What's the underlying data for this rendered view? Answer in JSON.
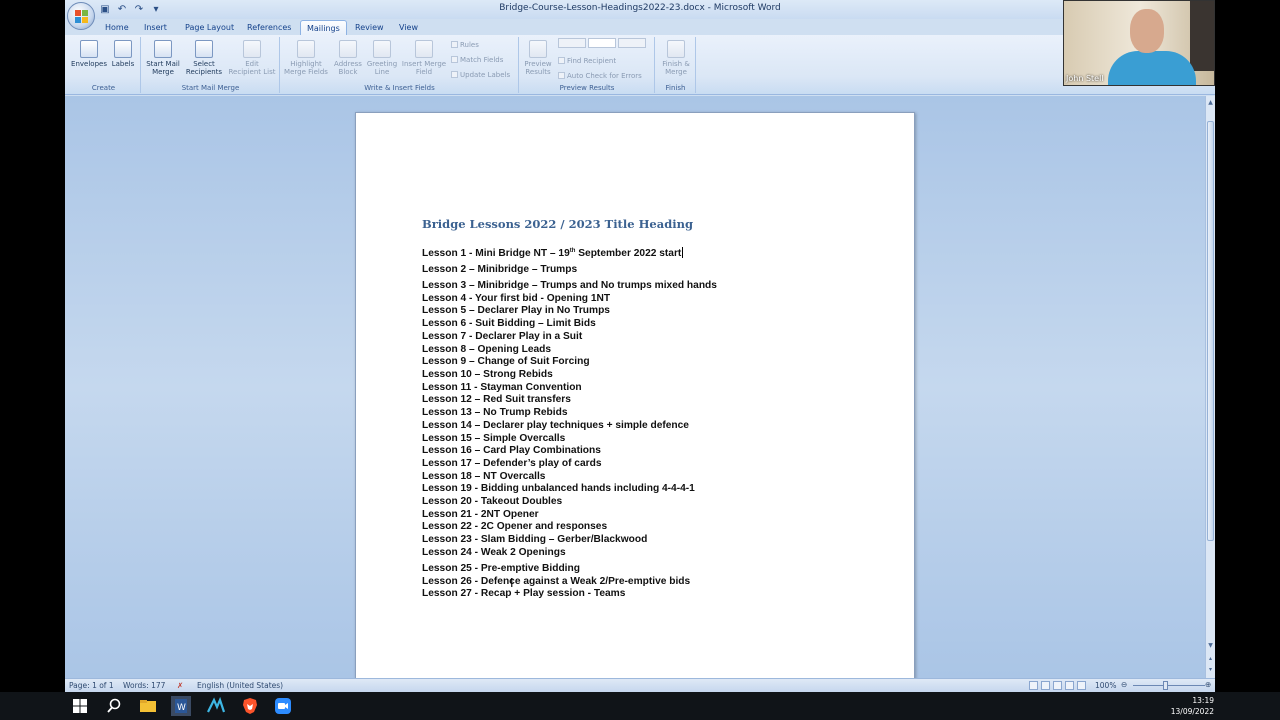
{
  "window": {
    "title": "Bridge-Course-Lesson-Headings2022-23.docx - Microsoft Word"
  },
  "tabs": [
    "Home",
    "Insert",
    "Page Layout",
    "References",
    "Mailings",
    "Review",
    "View"
  ],
  "active_tab": "Mailings",
  "ribbon": {
    "groups": {
      "create": "Create",
      "start_mail_merge": "Start Mail Merge",
      "write_insert": "Write & Insert Fields",
      "preview": "Preview Results",
      "finish": "Finish"
    },
    "buttons": {
      "envelopes": "Envelopes",
      "labels": "Labels",
      "start_mail_merge": "Start Mail Merge",
      "select_recipients": "Select Recipients",
      "edit_recipient_list": "Edit Recipient List",
      "highlight_merge_fields": "Highlight Merge Fields",
      "address_block": "Address Block",
      "greeting_line": "Greeting Line",
      "insert_merge_field": "Insert Merge Field",
      "rules": "Rules",
      "match_fields": "Match Fields",
      "update_labels": "Update Labels",
      "preview_results": "Preview Results",
      "find_recipient": "Find Recipient",
      "auto_check": "Auto Check for Errors",
      "finish_merge": "Finish & Merge"
    }
  },
  "document": {
    "heading": "Bridge Lessons 2022 / 2023 Title Heading",
    "lesson1": {
      "pre": "Lesson 1 - Mini Bridge NT – 19",
      "sup": "th",
      "post": " September 2022 start"
    },
    "lessons": [
      "Lesson 2 – Minibridge – Trumps",
      "Lesson 3 – Minibridge – Trumps and No trumps mixed hands",
      "Lesson 4 - Your first bid - Opening 1NT",
      "Lesson 5 – Declarer Play in No Trumps",
      "Lesson 6 - Suit Bidding – Limit Bids",
      "Lesson 7 - Declarer Play in a Suit",
      "Lesson 8 – Opening Leads",
      "Lesson 9 – Change of Suit Forcing",
      "Lesson 10 – Strong Rebids",
      "Lesson 11 - Stayman Convention",
      "Lesson 12 – Red Suit transfers",
      "Lesson 13 – No Trump Rebids",
      "Lesson 14 – Declarer play techniques + simple defence",
      "Lesson 15 – Simple Overcalls",
      "Lesson 16 – Card Play Combinations",
      "Lesson 17 – Defender’s play of cards",
      "Lesson 18 – NT Overcalls",
      "Lesson 19 - Bidding unbalanced hands including 4-4-4-1",
      "Lesson 20 - Takeout Doubles",
      "Lesson 21 - 2NT Opener",
      "Lesson 22 - 2C Opener and responses",
      "Lesson 23 - Slam Bidding – Gerber/Blackwood",
      "Lesson 24 - Weak 2 Openings",
      "Lesson 25 - Pre-emptive Bidding",
      "Lesson 26 - Defence against a Weak 2/Pre-emptive bids",
      "Lesson 27 - Recap + Play session - Teams"
    ]
  },
  "status": {
    "page": "Page: 1 of 1",
    "words": "Words: 177",
    "language": "English (United States)",
    "zoom": "100%"
  },
  "webcam": {
    "name": "John Stell"
  },
  "clock": {
    "time": "13:19",
    "date": "13/09/2022"
  }
}
